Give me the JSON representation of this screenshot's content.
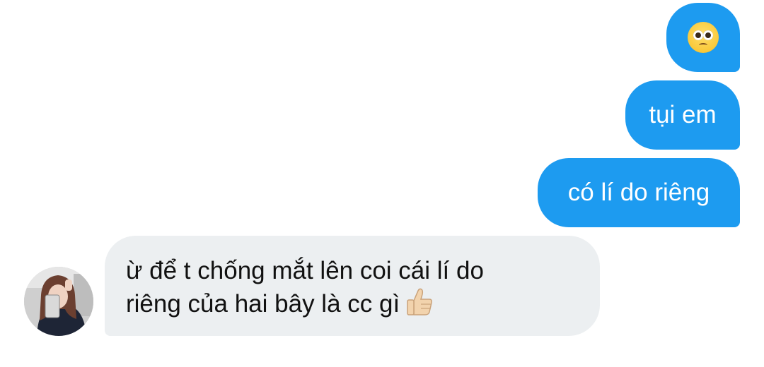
{
  "conversation": {
    "outgoing": [
      {
        "id": "msg-1",
        "emoji": "pleading-face",
        "text": ""
      },
      {
        "id": "msg-2",
        "text": "tụi em"
      },
      {
        "id": "msg-3",
        "text": "có lí do riêng"
      }
    ],
    "incoming": {
      "line1": "ừ để t chống mắt lên coi cái lí do",
      "line2": "riêng của hai bây là cc gì",
      "trailing_emoji": "thumbs-up-icon"
    }
  },
  "colors": {
    "outgoing_bubble": "#1d9bf0",
    "incoming_bubble": "#eceff1",
    "outgoing_text": "#ffffff",
    "incoming_text": "#111111"
  }
}
